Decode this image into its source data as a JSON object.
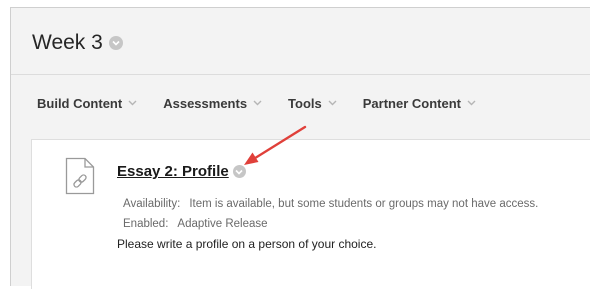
{
  "page": {
    "title": "Week 3"
  },
  "toolbar": {
    "items": [
      {
        "label": "Build Content"
      },
      {
        "label": "Assessments"
      },
      {
        "label": "Tools"
      },
      {
        "label": "Partner Content"
      }
    ]
  },
  "content_item": {
    "icon": "link-document-icon",
    "title": "Essay 2: Profile",
    "availability_label": "Availability:",
    "availability_value": "Item is available, but some students or groups may not have access.",
    "enabled_label": "Enabled:",
    "enabled_value": "Adaptive Release",
    "description": "Please write a profile on a person of your choice."
  },
  "annotation": {
    "arrow_color": "#e0403a"
  },
  "colors": {
    "background": "#f3f3f3",
    "content_background": "#ffffff",
    "text": "#262626",
    "muted_text": "#6a6a6a"
  }
}
